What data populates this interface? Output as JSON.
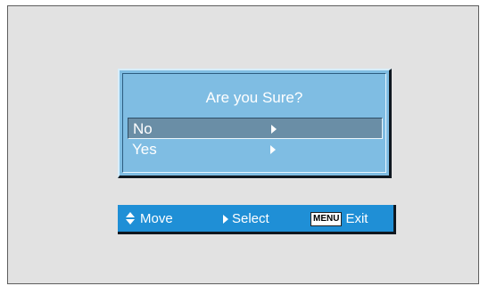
{
  "dialog": {
    "title": "Are you Sure?",
    "options": [
      {
        "label": "No",
        "selected": true
      },
      {
        "label": "Yes",
        "selected": false
      }
    ]
  },
  "footer": {
    "move_label": "Move",
    "select_label": "Select",
    "menu_key_label": "MENU",
    "exit_label": "Exit"
  },
  "icons": {
    "move": "up-down-arrows-icon",
    "select": "right-triangle-icon",
    "option_arrow": "right-triangle-icon"
  },
  "colors": {
    "screen_background": "#e2e2e2",
    "dialog_background": "#7fbde3",
    "selected_row": "#6a8ea6",
    "footer_background": "#1f8fd6",
    "text": "#ffffff"
  }
}
